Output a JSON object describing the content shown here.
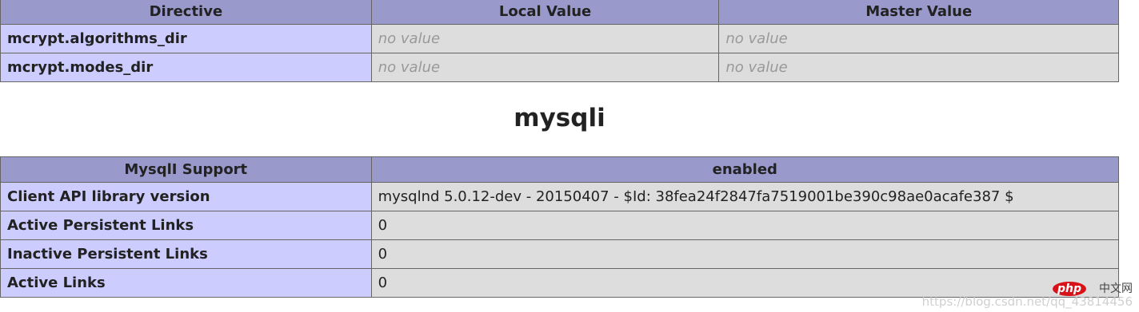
{
  "directives_table": {
    "headers": [
      "Directive",
      "Local Value",
      "Master Value"
    ],
    "rows": [
      {
        "name": "mcrypt.algorithms_dir",
        "local": "no value",
        "master": "no value"
      },
      {
        "name": "mcrypt.modes_dir",
        "local": "no value",
        "master": "no value"
      }
    ]
  },
  "section_title": "mysqli",
  "mysqli_table": {
    "headers": [
      "MysqlI Support",
      "enabled"
    ],
    "rows": [
      {
        "name": "Client API library version",
        "value": "mysqlnd 5.0.12-dev - 20150407 - $Id: 38fea24f2847fa7519001be390c98ae0acafe387 $"
      },
      {
        "name": "Active Persistent Links",
        "value": "0"
      },
      {
        "name": "Inactive Persistent Links",
        "value": "0"
      },
      {
        "name": "Active Links",
        "value": "0"
      }
    ]
  },
  "watermark": {
    "badge": "php",
    "site": "中文网",
    "url": "https://blog.csdn.net/qq_43814456"
  },
  "colors": {
    "header_bg": "#9999cc",
    "label_bg": "#ccccff",
    "value_bg": "#dddddd",
    "no_value_text": "#999999"
  }
}
